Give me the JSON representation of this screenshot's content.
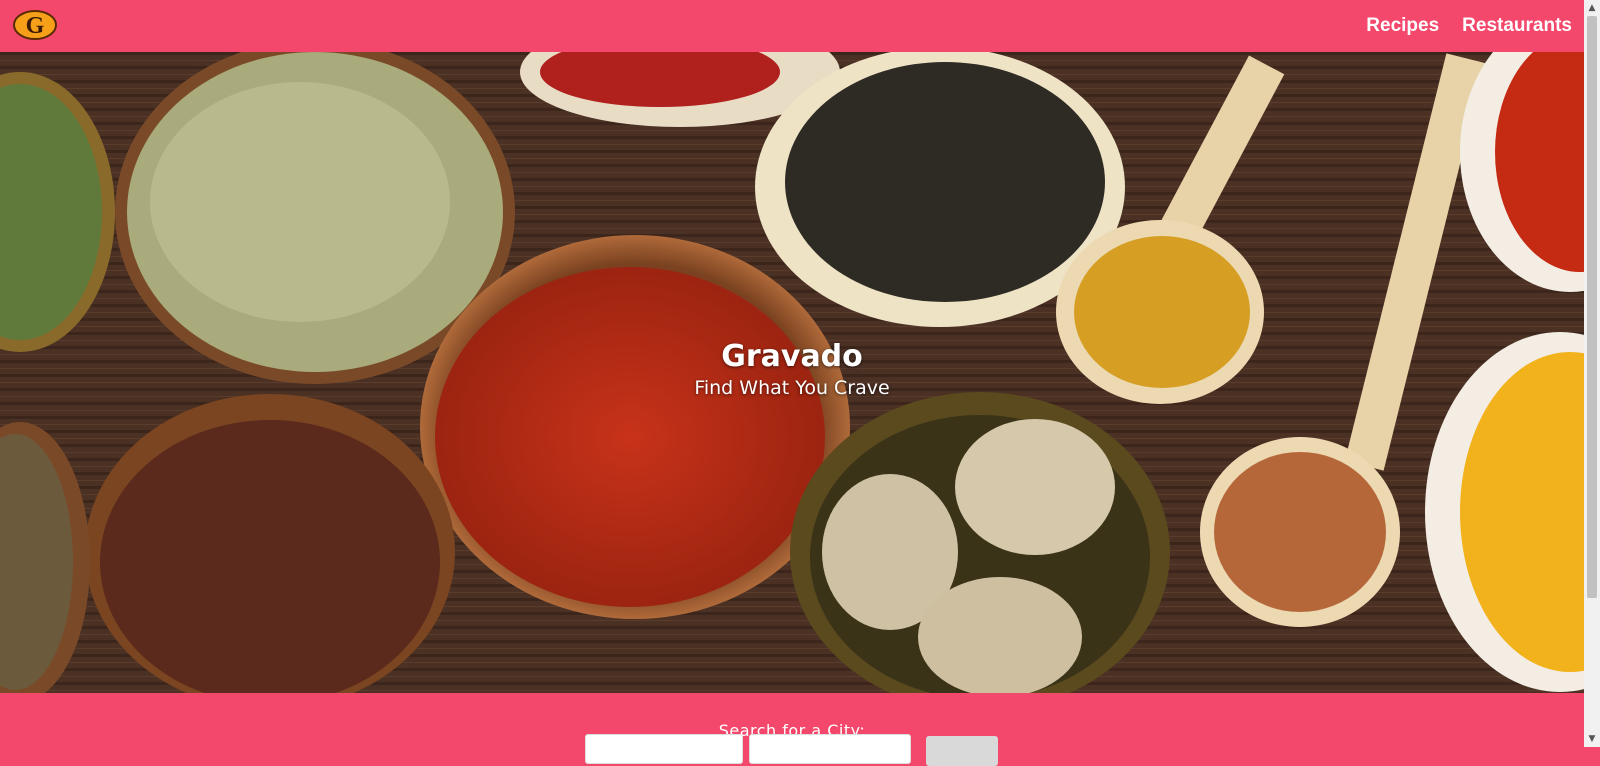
{
  "header": {
    "logo_letter": "G",
    "nav": [
      {
        "label": "Recipes"
      },
      {
        "label": "Restaurants"
      }
    ]
  },
  "hero": {
    "title": "Gravado",
    "subtitle": "Find What You Crave"
  },
  "search": {
    "label": "Search for a City:"
  },
  "colors": {
    "brand_pink": "#f3476b",
    "logo_orange": "#f6a01a"
  }
}
